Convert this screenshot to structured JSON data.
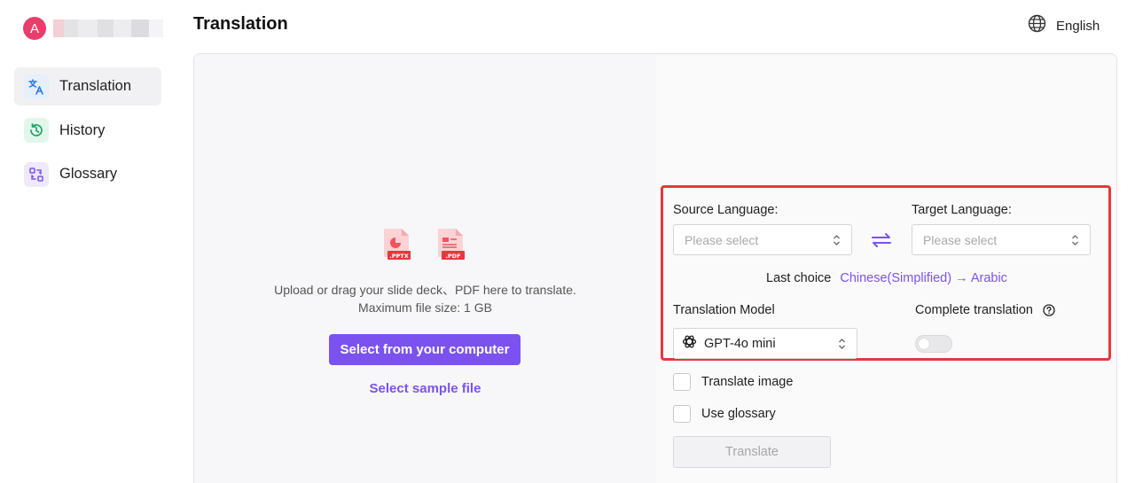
{
  "profile": {
    "avatar_letter": "A"
  },
  "sidebar": {
    "items": [
      {
        "label": "Translation",
        "icon": "translate-icon",
        "active": true
      },
      {
        "label": "History",
        "icon": "history-icon",
        "active": false
      },
      {
        "label": "Glossary",
        "icon": "glossary-icon",
        "active": false
      }
    ]
  },
  "header": {
    "title": "Translation",
    "language": "English",
    "language_icon": "globe-icon"
  },
  "upload": {
    "file_types": [
      "PPTX",
      "PDF"
    ],
    "instructions": "Upload or drag your slide deck、PDF here to translate.",
    "max_size": "Maximum file size: 1 GB",
    "select_button": "Select from your computer",
    "sample_link": "Select sample file"
  },
  "settings": {
    "source_label": "Source Language:",
    "source_placeholder": "Please select",
    "target_label": "Target Language:",
    "target_placeholder": "Please select",
    "last_choice_label": "Last choice",
    "last_choice_value": "Chinese(Simplified) → Arabic",
    "model_label": "Translation Model",
    "model_value": "GPT-4o mini",
    "complete_label": "Complete translation",
    "complete_enabled": false
  },
  "options": {
    "translate_image": "Translate image",
    "use_glossary": "Use glossary"
  },
  "actions": {
    "translate": "Translate"
  },
  "colors": {
    "accent": "#7b52f0",
    "highlight": "#e5393c",
    "avatar": "#e93e6a",
    "file_icon": "#f0545c"
  }
}
